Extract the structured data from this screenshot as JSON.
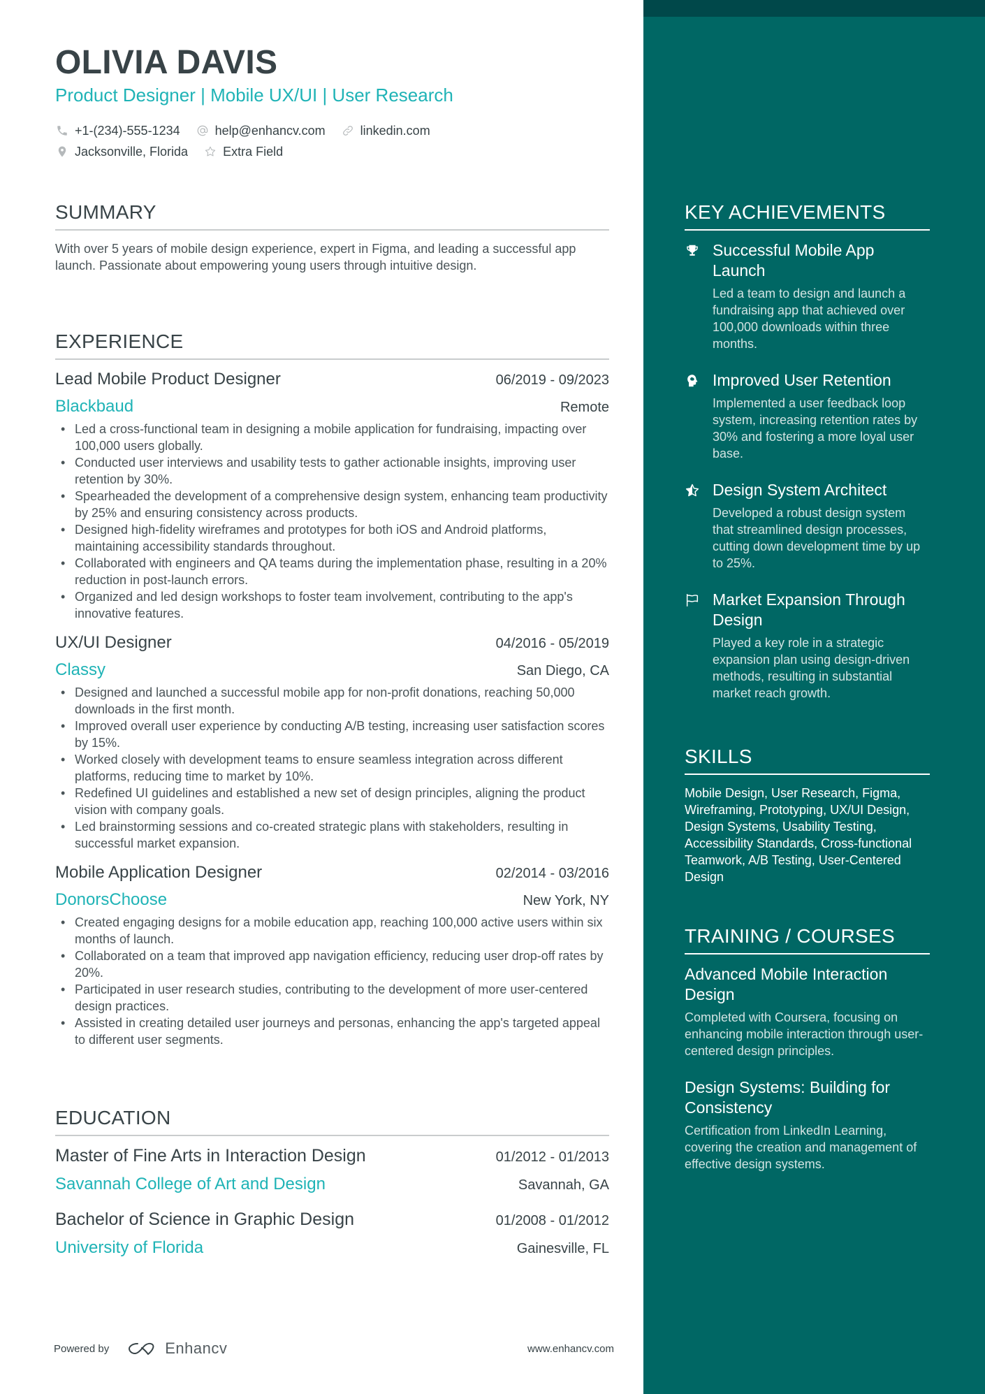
{
  "header": {
    "name": "OLIVIA DAVIS",
    "headline": "Product Designer | Mobile UX/UI | User Research",
    "contacts_row1": [
      {
        "icon": "phone-icon",
        "text": "+1-(234)-555-1234"
      },
      {
        "icon": "at-icon",
        "text": "help@enhancv.com"
      },
      {
        "icon": "link-icon",
        "text": "linkedin.com"
      }
    ],
    "contacts_row2": [
      {
        "icon": "location-pin-icon",
        "text": "Jacksonville, Florida"
      },
      {
        "icon": "star-icon",
        "text": "Extra Field"
      }
    ]
  },
  "summary": {
    "title": "SUMMARY",
    "text": "With over 5 years of mobile design experience, expert in Figma, and leading a successful app launch. Passionate about empowering young users through intuitive design."
  },
  "experience": {
    "title": "EXPERIENCE",
    "jobs": [
      {
        "title": "Lead Mobile Product Designer",
        "dates": "06/2019 - 09/2023",
        "company": "Blackbaud",
        "location": "Remote",
        "bullets": [
          "Led a cross-functional team in designing a mobile application for fundraising, impacting over 100,000 users globally.",
          "Conducted user interviews and usability tests to gather actionable insights, improving user retention by 30%.",
          "Spearheaded the development of a comprehensive design system, enhancing team productivity by 25% and ensuring consistency across products.",
          "Designed high-fidelity wireframes and prototypes for both iOS and Android platforms, maintaining accessibility standards throughout.",
          "Collaborated with engineers and QA teams during the implementation phase, resulting in a 20% reduction in post-launch errors.",
          "Organized and led design workshops to foster team involvement, contributing to the app's innovative features."
        ]
      },
      {
        "title": "UX/UI Designer",
        "dates": "04/2016 - 05/2019",
        "company": "Classy",
        "location": "San Diego, CA",
        "bullets": [
          "Designed and launched a successful mobile app for non-profit donations, reaching 50,000 downloads in the first month.",
          "Improved overall user experience by conducting A/B testing, increasing user satisfaction scores by 15%.",
          "Worked closely with development teams to ensure seamless integration across different platforms, reducing time to market by 10%.",
          "Redefined UI guidelines and established a new set of design principles, aligning the product vision with company goals.",
          "Led brainstorming sessions and co-created strategic plans with stakeholders, resulting in successful market expansion."
        ]
      },
      {
        "title": "Mobile Application Designer",
        "dates": "02/2014 - 03/2016",
        "company": "DonorsChoose",
        "location": "New York, NY",
        "bullets": [
          "Created engaging designs for a mobile education app, reaching 100,000 active users within six months of launch.",
          "Collaborated on a team that improved app navigation efficiency, reducing user drop-off rates by 20%.",
          "Participated in user research studies, contributing to the development of more user-centered design practices.",
          "Assisted in creating detailed user journeys and personas, enhancing the app's targeted appeal to different user segments."
        ]
      }
    ]
  },
  "education": {
    "title": "EDUCATION",
    "items": [
      {
        "degree": "Master of Fine Arts in Interaction Design",
        "dates": "01/2012 - 01/2013",
        "school": "Savannah College of Art and Design",
        "location": "Savannah, GA"
      },
      {
        "degree": "Bachelor of Science in Graphic Design",
        "dates": "01/2008 - 01/2012",
        "school": "University of Florida",
        "location": "Gainesville, FL"
      }
    ]
  },
  "achievements": {
    "title": "KEY ACHIEVEMENTS",
    "items": [
      {
        "icon": "trophy-icon",
        "title": "Successful Mobile App Launch",
        "desc": "Led a team to design and launch a fundraising app that achieved over 100,000 downloads within three months."
      },
      {
        "icon": "head-brain-icon",
        "title": "Improved User Retention",
        "desc": "Implemented a user feedback loop system, increasing retention rates by 30% and fostering a more loyal user base."
      },
      {
        "icon": "half-star-icon",
        "title": "Design System Architect",
        "desc": "Developed a robust design system that streamlined design processes, cutting down development time by up to 25%."
      },
      {
        "icon": "flag-icon",
        "title": "Market Expansion Through Design",
        "desc": "Played a key role in a strategic expansion plan using design-driven methods, resulting in substantial market reach growth."
      }
    ]
  },
  "skills": {
    "title": "SKILLS",
    "text": "Mobile Design, User Research, Figma, Wireframing, Prototyping, UX/UI Design, Design Systems, Usability Testing, Accessibility Standards, Cross-functional Teamwork, A/B Testing, User-Centered Design"
  },
  "training": {
    "title": "TRAINING / COURSES",
    "items": [
      {
        "title": "Advanced Mobile Interaction Design",
        "desc": "Completed with Coursera, focusing on enhancing mobile interaction through user-centered design principles."
      },
      {
        "title": "Design Systems: Building for Consistency",
        "desc": "Certification from LinkedIn Learning, covering the creation and management of effective design systems."
      }
    ]
  },
  "footer": {
    "powered_by": "Powered by",
    "brand": "Enhancv",
    "site": "www.enhancv.com"
  },
  "colors": {
    "accent": "#1fb3b6",
    "sidebar_bg": "#006764",
    "sidebar_topband": "#00484a",
    "text": "#384347"
  }
}
